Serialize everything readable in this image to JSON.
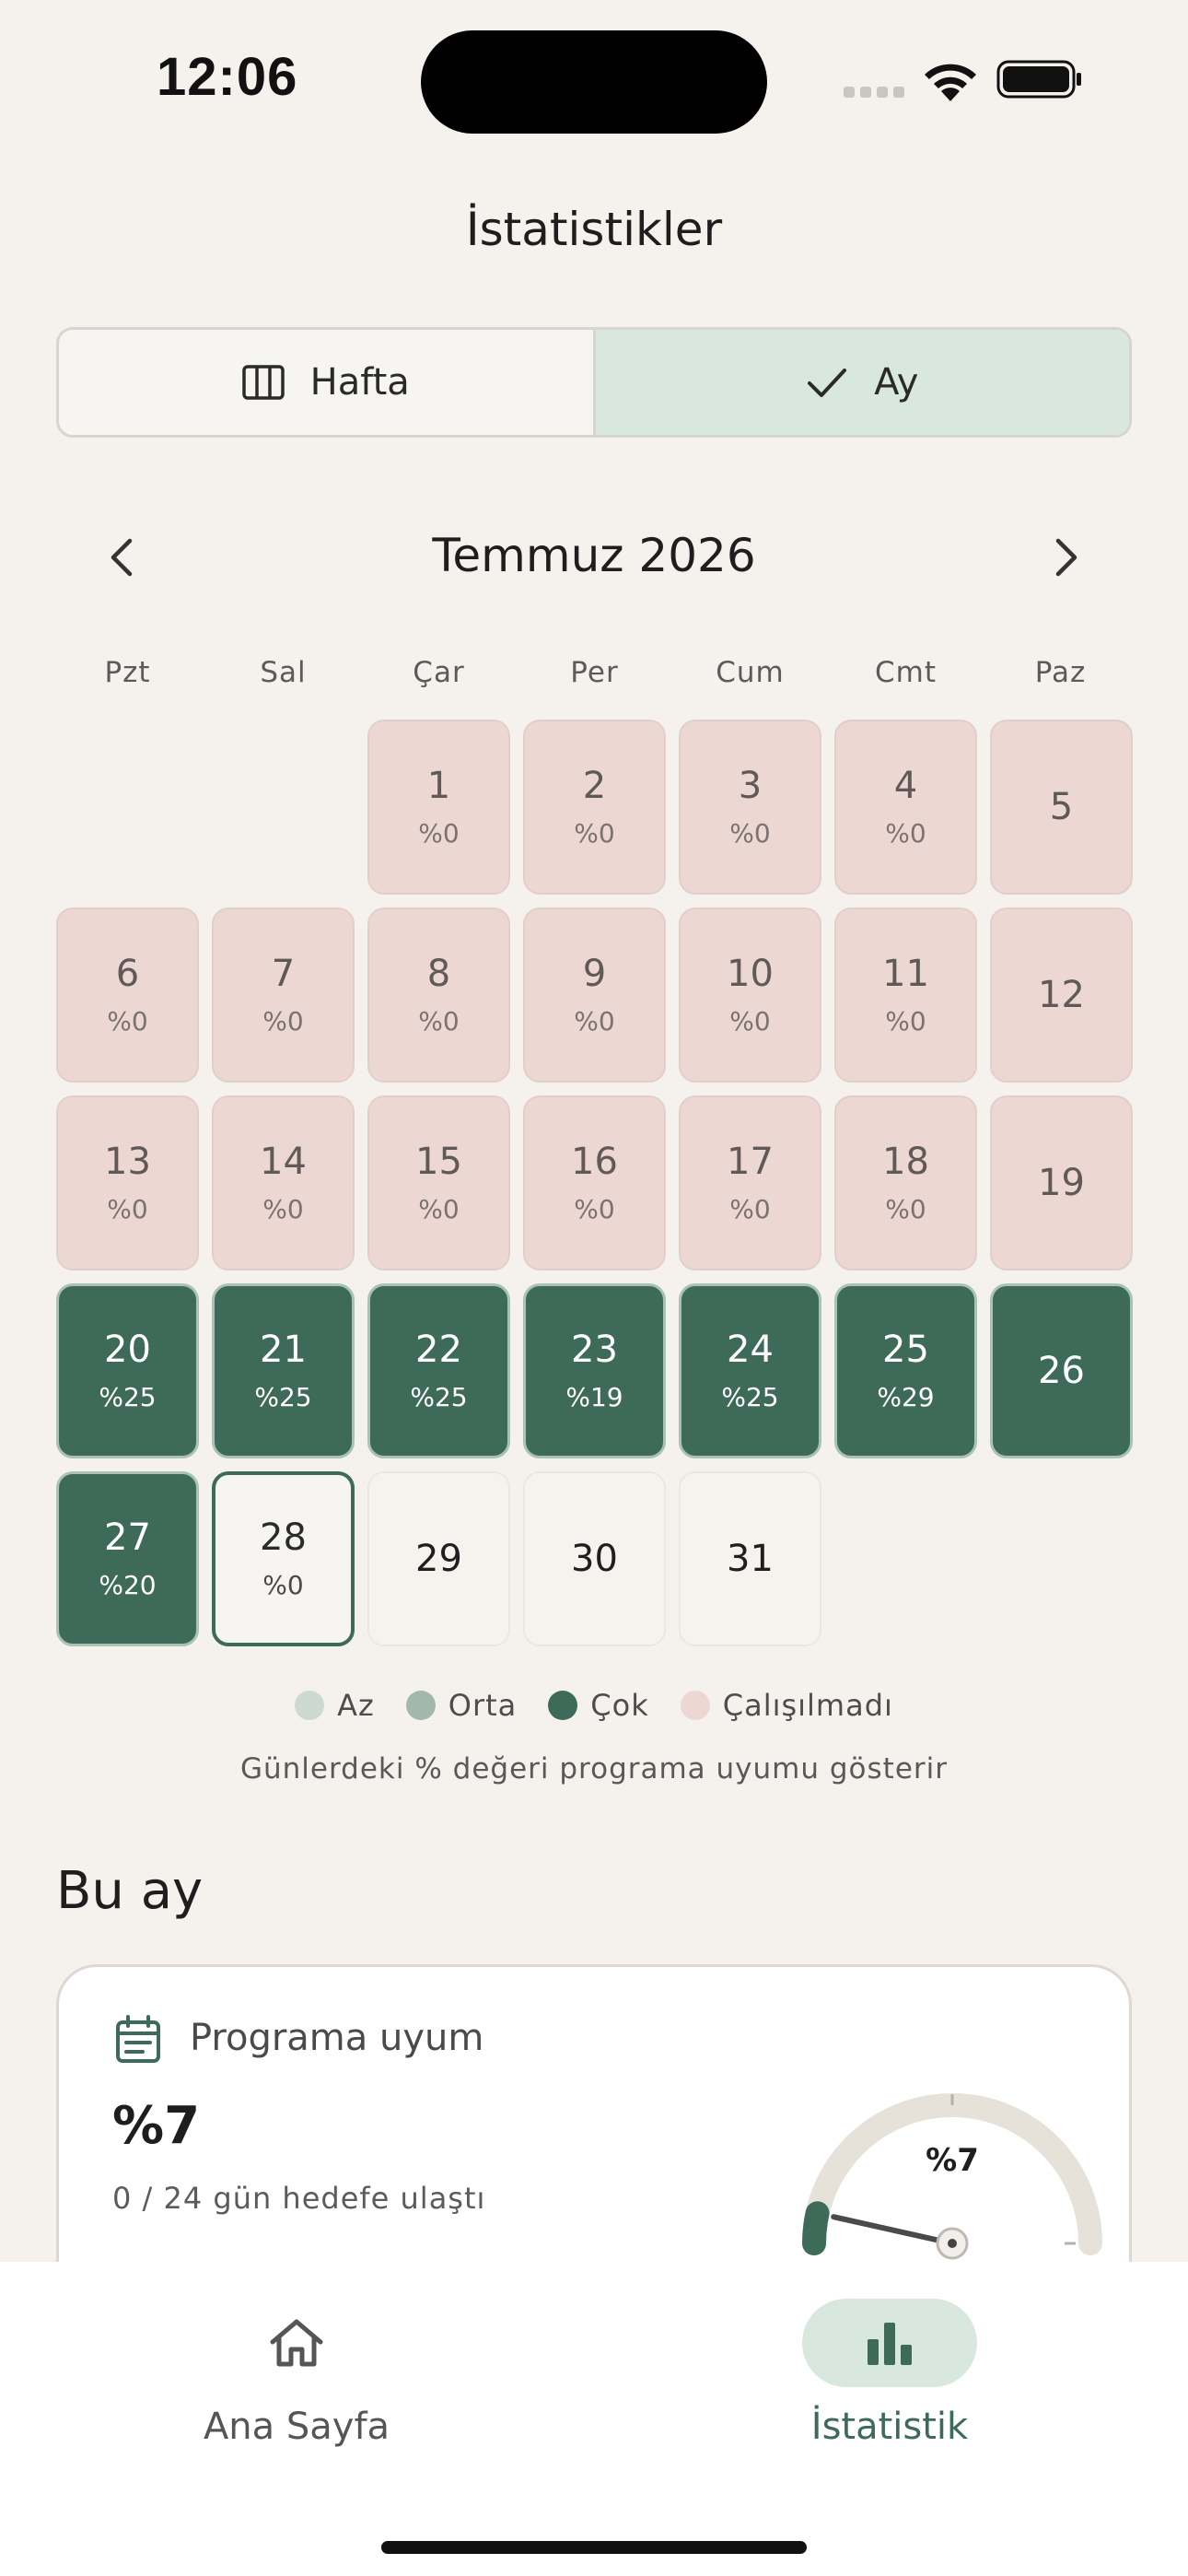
{
  "status": {
    "time": "12:06"
  },
  "title": "İstatistikler",
  "segmented": {
    "week_label": "Hafta",
    "month_label": "Ay",
    "selected": "month"
  },
  "month_nav": {
    "title": "Temmuz 2026"
  },
  "weekdays": [
    "Pzt",
    "Sal",
    "Çar",
    "Per",
    "Cum",
    "Cmt",
    "Paz"
  ],
  "days": [
    {
      "num": "1",
      "pct": "%0",
      "status": "miss"
    },
    {
      "num": "2",
      "pct": "%0",
      "status": "miss"
    },
    {
      "num": "3",
      "pct": "%0",
      "status": "miss"
    },
    {
      "num": "4",
      "pct": "%0",
      "status": "miss"
    },
    {
      "num": "5",
      "pct": "",
      "status": "miss"
    },
    {
      "num": "6",
      "pct": "%0",
      "status": "miss"
    },
    {
      "num": "7",
      "pct": "%0",
      "status": "miss"
    },
    {
      "num": "8",
      "pct": "%0",
      "status": "miss"
    },
    {
      "num": "9",
      "pct": "%0",
      "status": "miss"
    },
    {
      "num": "10",
      "pct": "%0",
      "status": "miss"
    },
    {
      "num": "11",
      "pct": "%0",
      "status": "miss"
    },
    {
      "num": "12",
      "pct": "",
      "status": "miss"
    },
    {
      "num": "13",
      "pct": "%0",
      "status": "miss"
    },
    {
      "num": "14",
      "pct": "%0",
      "status": "miss"
    },
    {
      "num": "15",
      "pct": "%0",
      "status": "miss"
    },
    {
      "num": "16",
      "pct": "%0",
      "status": "miss"
    },
    {
      "num": "17",
      "pct": "%0",
      "status": "miss"
    },
    {
      "num": "18",
      "pct": "%0",
      "status": "miss"
    },
    {
      "num": "19",
      "pct": "",
      "status": "miss"
    },
    {
      "num": "20",
      "pct": "%25",
      "status": "high"
    },
    {
      "num": "21",
      "pct": "%25",
      "status": "high"
    },
    {
      "num": "22",
      "pct": "%25",
      "status": "high"
    },
    {
      "num": "23",
      "pct": "%19",
      "status": "high"
    },
    {
      "num": "24",
      "pct": "%25",
      "status": "high"
    },
    {
      "num": "25",
      "pct": "%29",
      "status": "high"
    },
    {
      "num": "26",
      "pct": "",
      "status": "high"
    },
    {
      "num": "27",
      "pct": "%20",
      "status": "high"
    },
    {
      "num": "28",
      "pct": "%0",
      "status": "today"
    },
    {
      "num": "29",
      "pct": "",
      "status": "future"
    },
    {
      "num": "30",
      "pct": "",
      "status": "future"
    },
    {
      "num": "31",
      "pct": "",
      "status": "future"
    }
  ],
  "legend": {
    "items": [
      {
        "label": "Az",
        "color": "#cdd8d1"
      },
      {
        "label": "Orta",
        "color": "#a3b8ac"
      },
      {
        "label": "Çok",
        "color": "#3e6b59"
      },
      {
        "label": "Çalışılmadı",
        "color": "#ecd7d2"
      }
    ],
    "note": "Günlerdeki % değeri programa uyumu gösterir"
  },
  "section_title": "Bu ay",
  "card": {
    "icon": "calendar-icon",
    "label": "Programa uyum",
    "value": "%7",
    "subtitle": "0 / 24 gün hedefe ulaştı",
    "gauge_text": "%7",
    "gauge_percent": 7
  },
  "tabs": {
    "home_label": "Ana Sayfa",
    "stats_label": "İstatistik",
    "active": "stats"
  },
  "colors": {
    "accent": "#3e6b59",
    "accent_light": "#d9e8df",
    "miss": "#ecd7d2",
    "background": "#f5f2ee"
  }
}
